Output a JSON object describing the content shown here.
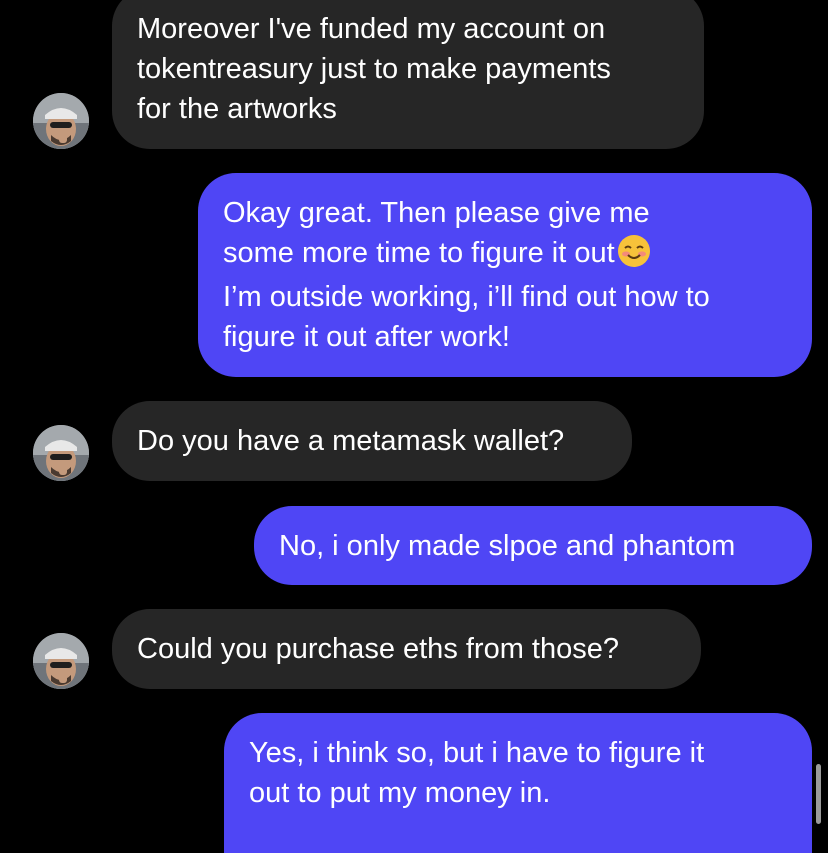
{
  "colors": {
    "background": "#000000",
    "incoming_bubble": "#262626",
    "outgoing_bubble": "#4f46f5",
    "text": "#ffffff"
  },
  "messages": [
    {
      "sender": "contact",
      "lines": [
        "Moreover I've funded my account on",
        "tokentreasury just to make payments",
        "for the artworks"
      ]
    },
    {
      "sender": "me",
      "lines": [
        "Okay great. Then please give me",
        "some more time to figure it out",
        "I’m outside working, i’ll find out how to",
        "figure it out after work!"
      ],
      "emoji": "smiling-face-icon"
    },
    {
      "sender": "contact",
      "lines": [
        "Do you have a metamask wallet?"
      ]
    },
    {
      "sender": "me",
      "lines": [
        "No, i only made slpoe and phantom"
      ]
    },
    {
      "sender": "contact",
      "lines": [
        "Could you purchase eths from those?"
      ]
    },
    {
      "sender": "me",
      "lines": [
        "Yes, i think so, but i have to figure it",
        "out to put my money in."
      ]
    }
  ]
}
